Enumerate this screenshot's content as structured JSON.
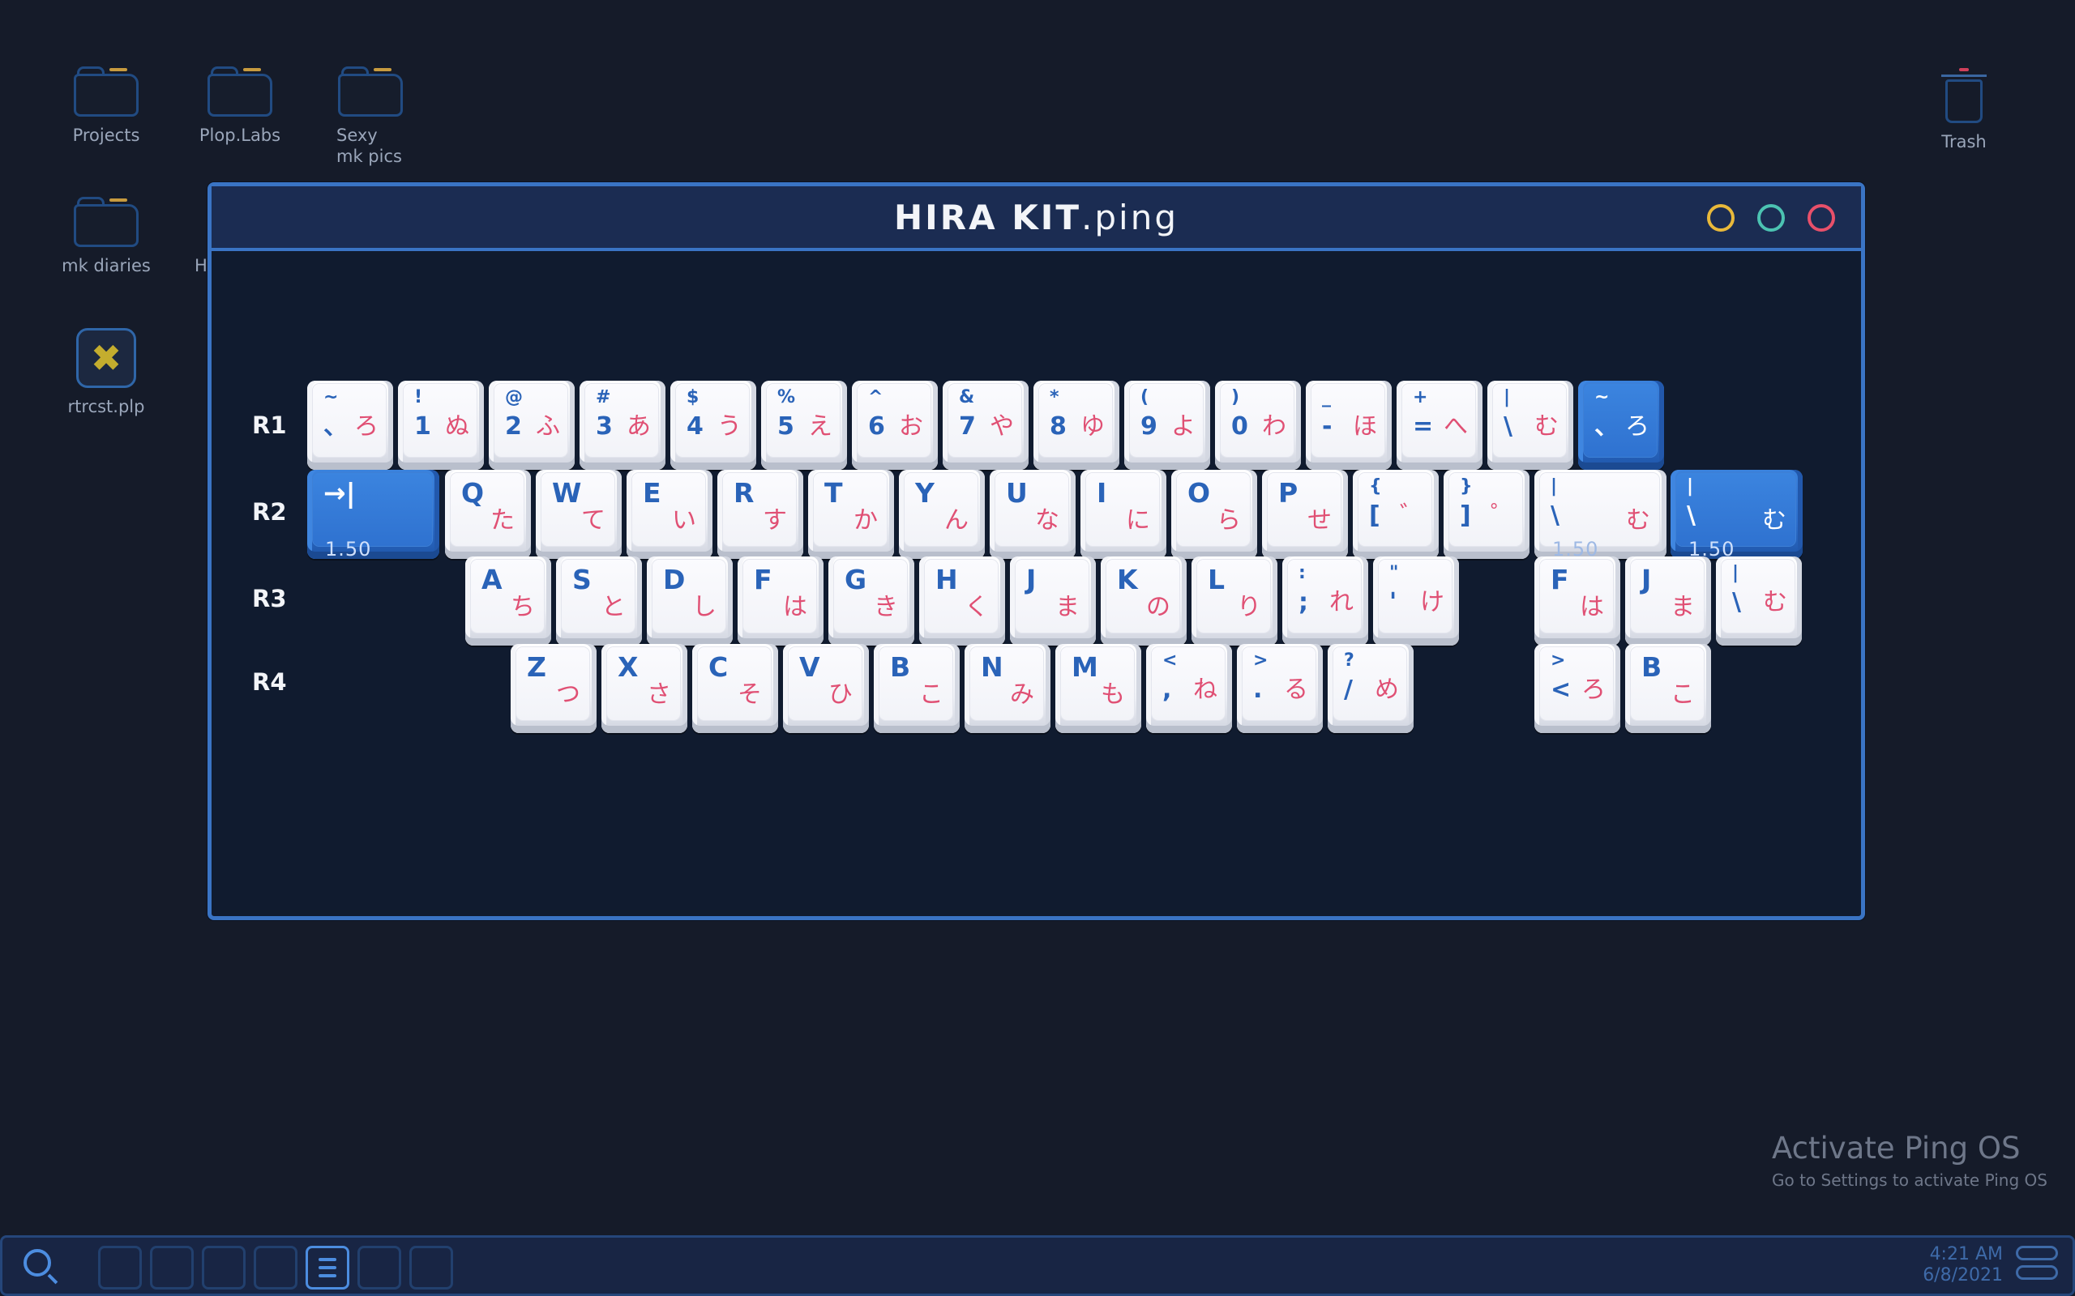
{
  "desktop": {
    "icons": [
      {
        "label": "Projects"
      },
      {
        "label": "Plop.Labs"
      },
      {
        "label": "Sexy mk pics"
      },
      {
        "label": "mk diaries"
      },
      {
        "label": "H"
      },
      {
        "label": "rtrcst.plp"
      },
      {
        "label": "Trash"
      }
    ]
  },
  "window": {
    "title_main": "HIRA KIT",
    "title_ext": ".ping"
  },
  "rows": [
    "R1",
    "R2",
    "R3",
    "R4"
  ],
  "keys": {
    "r1": [
      {
        "a": "~",
        "b": "、",
        "k": "ろ"
      },
      {
        "a": "!",
        "b": "1",
        "k": "ぬ"
      },
      {
        "a": "@",
        "b": "2",
        "k": "ふ"
      },
      {
        "a": "#",
        "b": "3",
        "k": "あ"
      },
      {
        "a": "$",
        "b": "4",
        "k": "う"
      },
      {
        "a": "%",
        "b": "5",
        "k": "え"
      },
      {
        "a": "^",
        "b": "6",
        "k": "お"
      },
      {
        "a": "&",
        "b": "7",
        "k": "や"
      },
      {
        "a": "*",
        "b": "8",
        "k": "ゆ"
      },
      {
        "a": "(",
        "b": "9",
        "k": "よ"
      },
      {
        "a": ")",
        "b": "0",
        "k": "わ"
      },
      {
        "a": "_",
        "b": "-",
        "k": "ほ"
      },
      {
        "a": "+",
        "b": "=",
        "k": "へ"
      },
      {
        "a": "|",
        "b": "\\",
        "k": "む"
      },
      {
        "a": "~",
        "b": "、",
        "k": "ろ"
      }
    ],
    "r2_tab": {
      "glyph": "→|",
      "size": "1.50"
    },
    "r2": [
      {
        "a": "Q",
        "k": "た"
      },
      {
        "a": "W",
        "k": "て"
      },
      {
        "a": "E",
        "k": "い"
      },
      {
        "a": "R",
        "k": "す"
      },
      {
        "a": "T",
        "k": "か"
      },
      {
        "a": "Y",
        "k": "ん"
      },
      {
        "a": "U",
        "k": "な"
      },
      {
        "a": "I",
        "k": "に"
      },
      {
        "a": "O",
        "k": "ら"
      },
      {
        "a": "P",
        "k": "せ"
      },
      {
        "a": "{",
        "b": "[",
        "k": "゛"
      },
      {
        "a": "}",
        "b": "]",
        "k": "゜"
      }
    ],
    "r2_wide": [
      {
        "a": "|",
        "b": "\\",
        "k": "む",
        "size": "1.50"
      },
      {
        "a": "|",
        "b": "\\",
        "k": "む",
        "size": "1.50"
      }
    ],
    "r3": [
      {
        "a": "A",
        "k": "ち"
      },
      {
        "a": "S",
        "k": "と"
      },
      {
        "a": "D",
        "k": "し"
      },
      {
        "a": "F",
        "k": "は"
      },
      {
        "a": "G",
        "k": "き"
      },
      {
        "a": "H",
        "k": "く"
      },
      {
        "a": "J",
        "k": "ま"
      },
      {
        "a": "K",
        "k": "の"
      },
      {
        "a": "L",
        "k": "り"
      },
      {
        "a": ":",
        "b": ";",
        "k": "れ"
      },
      {
        "a": "\"",
        "b": "'",
        "k": "け"
      }
    ],
    "r3_extra": [
      {
        "a": "F",
        "k": "は"
      },
      {
        "a": "J",
        "k": "ま"
      },
      {
        "a": "|",
        "b": "\\",
        "k": "む"
      }
    ],
    "r4": [
      {
        "a": "Z",
        "k": "つ"
      },
      {
        "a": "X",
        "k": "さ"
      },
      {
        "a": "C",
        "k": "そ"
      },
      {
        "a": "V",
        "k": "ひ"
      },
      {
        "a": "B",
        "k": "こ"
      },
      {
        "a": "N",
        "k": "み"
      },
      {
        "a": "M",
        "k": "も"
      },
      {
        "a": "<",
        "b": ",",
        "k": "ね"
      },
      {
        "a": ">",
        "b": ".",
        "k": "る"
      },
      {
        "a": "?",
        "b": "/",
        "k": "め"
      }
    ],
    "r4_extra": [
      {
        "a": ">",
        "b": "<",
        "k": "ろ"
      },
      {
        "a": "B",
        "k": "こ"
      }
    ]
  },
  "watermark": {
    "title": "Activate Ping OS",
    "subtitle": "Go to Settings to activate Ping OS"
  },
  "taskbar": {
    "time": "4:21 AM",
    "date": "6/8/2021"
  },
  "colors": {
    "accent": "#3a74c4",
    "legend_blue": "#2a63b8",
    "legend_pink": "#e05074"
  }
}
